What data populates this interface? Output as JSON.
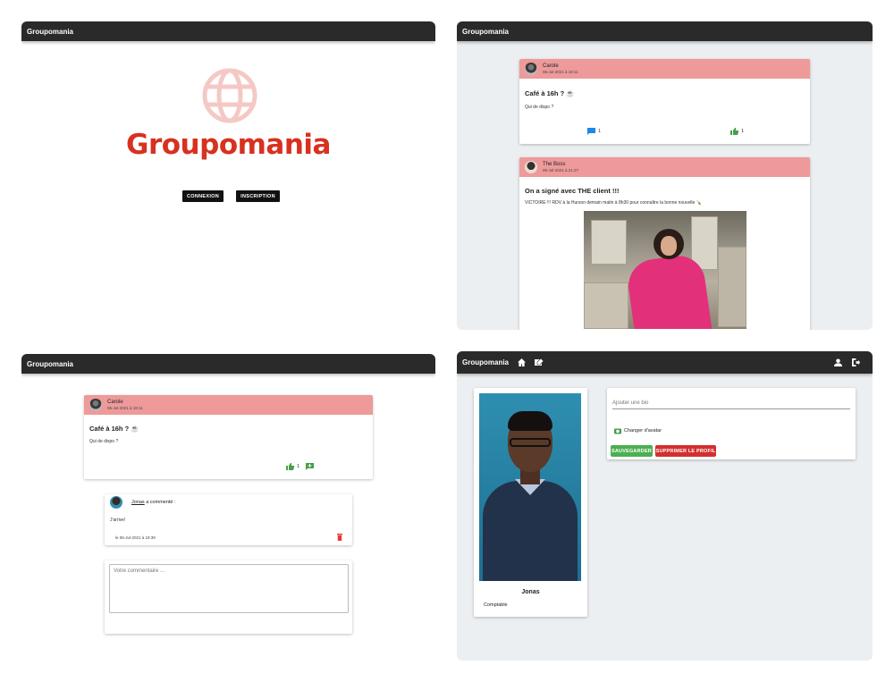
{
  "brand": "Groupomania",
  "colors": {
    "brand_red": "#d8311f",
    "post_header": "#ee9a9a",
    "appbar": "#2a2a2a",
    "save_green": "#4caf50",
    "delete_red": "#d32f2f"
  },
  "login": {
    "logo_text": "Groupomania",
    "connexion_label": "CONNEXION",
    "inscription_label": "INSCRIPTION"
  },
  "feed": {
    "posts": [
      {
        "author": "Carole",
        "date": "06-Jul-2021 à 18:11",
        "title": "Café à 16h ? ☕",
        "body": "Qui de dispo ?",
        "comments": "1",
        "likes": "1"
      },
      {
        "author": "The Boss",
        "date": "05-Jul-2021 à 21:37",
        "title": "On a signé avec THE client !!!",
        "body": "VICTOIRE !!! RDV à la Hurson demain matin à 8h30 pour connaître la bonne nouvelle 🍾"
      }
    ]
  },
  "post_detail": {
    "post": {
      "author": "Carole",
      "date": "06-Jul-2021 à 18:11",
      "title": "Café à 16h ? ☕",
      "body": "Qui de dispo ?",
      "likes": "1"
    },
    "comment": {
      "author": "Jonas",
      "suffix": "a commenté :",
      "text": "J'arrive!",
      "date": "le 06-Jul-2021 à 18:39"
    },
    "comment_placeholder": "Votre commentaire ..."
  },
  "profile": {
    "name": "Jonas",
    "job": "Comptable",
    "bio_placeholder": "Ajouter une bio",
    "change_avatar_label": "Changer d'avatar",
    "save_label": "SAUVEGARDER",
    "delete_label": "SUPPRIMER LE PROFIL"
  }
}
